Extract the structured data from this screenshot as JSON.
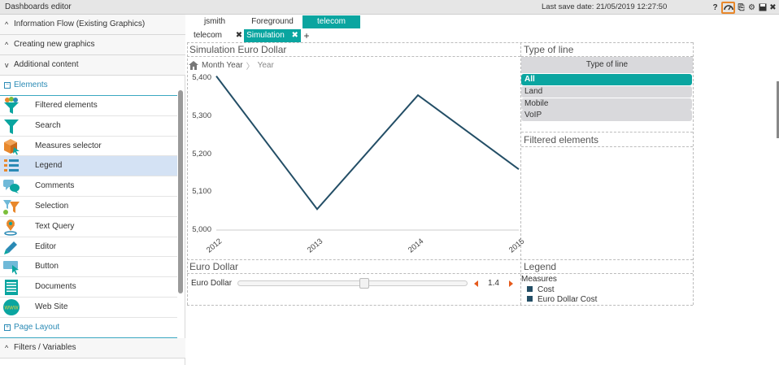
{
  "app": {
    "title": "Dashboards editor",
    "save_date": "Last save date: 21/05/2019 12:27:50"
  },
  "sidebar": {
    "accordions": [
      {
        "label": "Information Flow (Existing Graphics)",
        "chevron": "^"
      },
      {
        "label": "Creating new graphics",
        "chevron": "^"
      },
      {
        "label": "Additional content",
        "chevron": "v"
      }
    ],
    "elements_section": "Elements",
    "elements": [
      {
        "label": "Filtered elements",
        "icon": "funnel-multi-icon"
      },
      {
        "label": "Search",
        "icon": "funnel-icon"
      },
      {
        "label": "Measures selector",
        "icon": "cube-cursor-icon"
      },
      {
        "label": "Legend",
        "icon": "list-icon"
      },
      {
        "label": "Comments",
        "icon": "speech-bubbles-icon"
      },
      {
        "label": "Selection",
        "icon": "selection-icon"
      },
      {
        "label": "Text Query",
        "icon": "location-query-icon"
      },
      {
        "label": "Editor",
        "icon": "pencil-icon"
      },
      {
        "label": "Button",
        "icon": "button-cursor-icon"
      },
      {
        "label": "Documents",
        "icon": "document-icon"
      },
      {
        "label": "Web Site",
        "icon": "globe-www-icon"
      }
    ],
    "page_layout_section": "Page Layout",
    "filters_accordion": "Filters / Variables"
  },
  "tabs": {
    "row1": [
      "jsmith",
      "Foreground",
      "telecom"
    ],
    "row2": [
      {
        "label": "telecom",
        "close": "✖"
      },
      {
        "label": "Simulation",
        "close": "✖"
      }
    ],
    "add": "+"
  },
  "chart_panel": {
    "title": "Simulation Euro Dollar",
    "crumb_1": "Month Year",
    "crumb_2": "Year"
  },
  "chart_data": {
    "type": "line",
    "x": [
      "2012",
      "2013",
      "2014",
      "2015"
    ],
    "series": [
      {
        "values": [
          5405,
          5055,
          5355,
          5160
        ]
      }
    ],
    "ylim": [
      5000,
      5400
    ],
    "yticks": [
      "5,400",
      "5,300",
      "5,200",
      "5,100",
      "5,000"
    ],
    "color": "#234e66"
  },
  "type_of_line": {
    "title": "Type of line",
    "header": "Type of line",
    "items": [
      "All",
      "Land",
      "Mobile",
      "VoIP"
    ],
    "active_color": "#0aa5a0"
  },
  "filtered_elements": {
    "title": "Filtered elements"
  },
  "euro_dollar": {
    "title": "Euro Dollar",
    "label": "Euro Dollar",
    "value": "1.4",
    "slider_fraction": 0.55
  },
  "legend": {
    "title": "Legend",
    "heading": "Measures",
    "items": [
      "Cost",
      "Euro Dollar Cost"
    ]
  }
}
